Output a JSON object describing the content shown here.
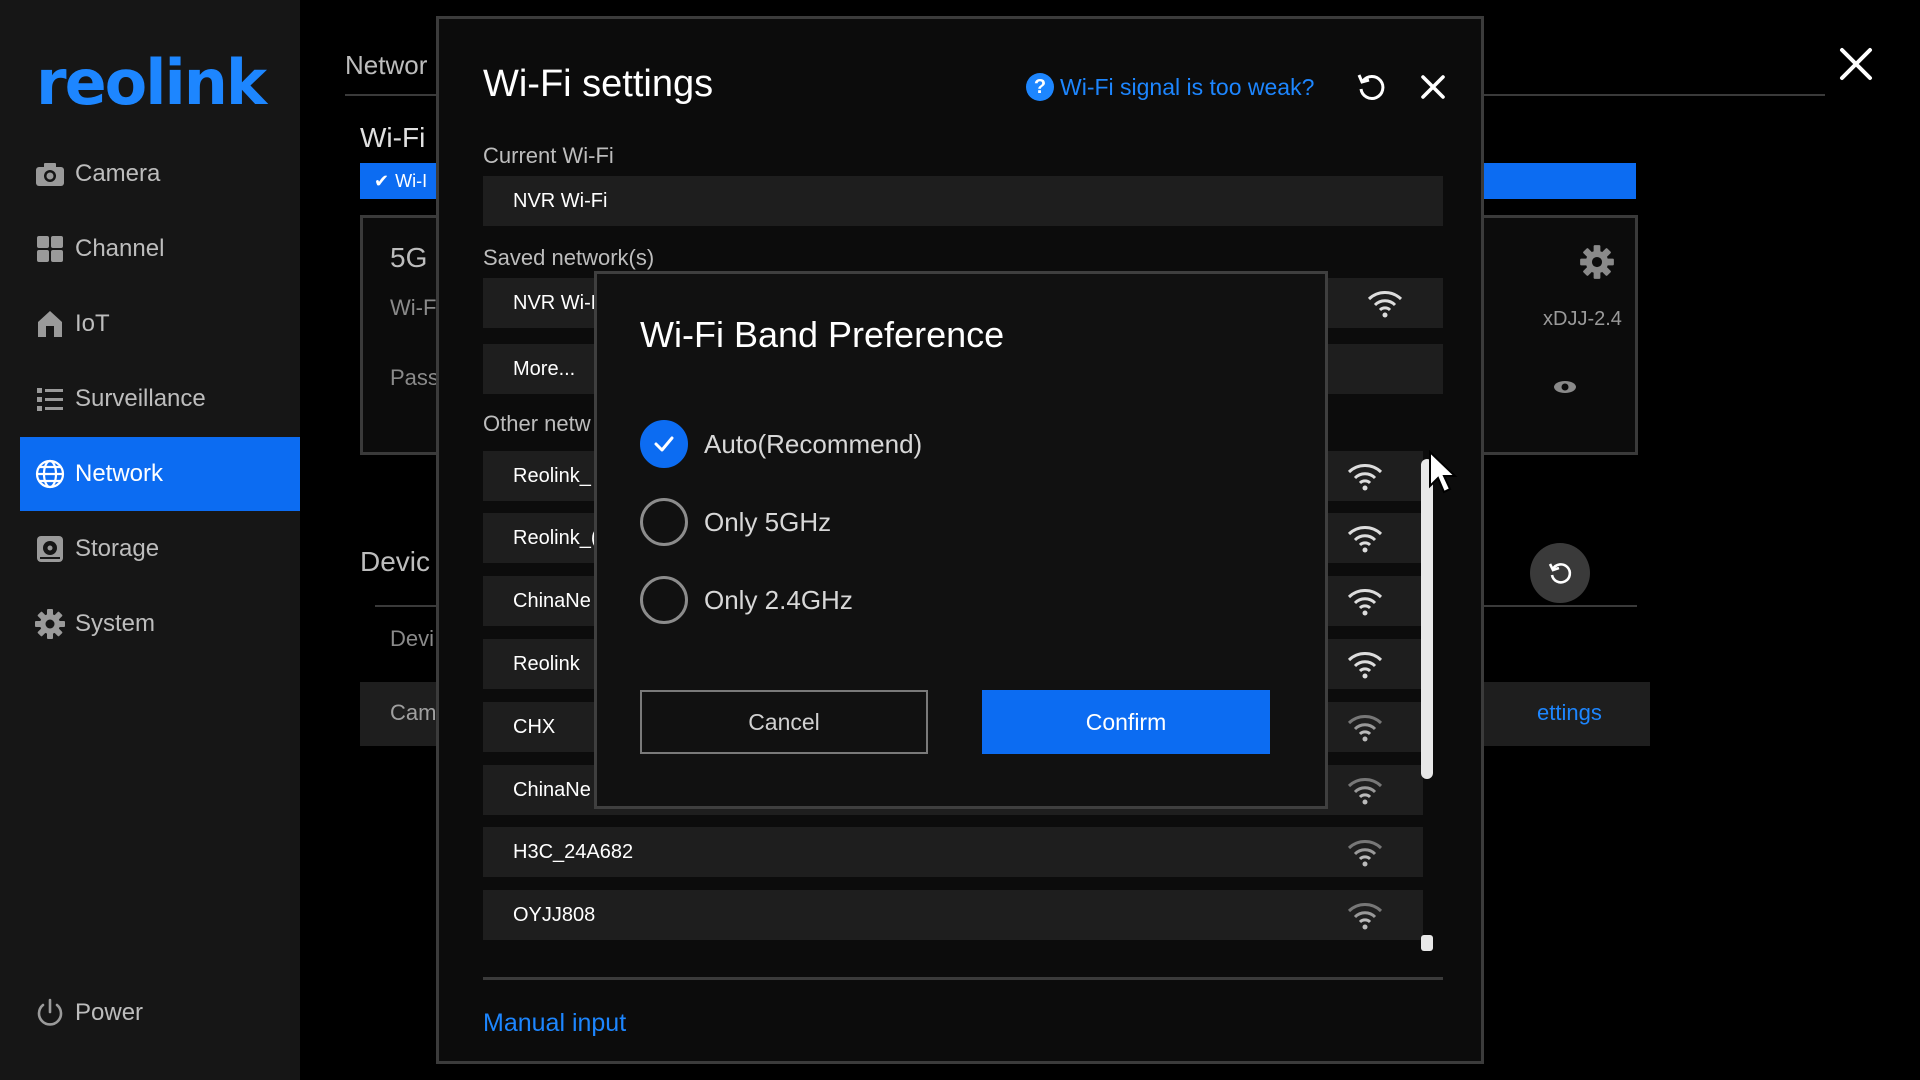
{
  "brand": {
    "logo_text": "reolink",
    "accent": "#0c6cf2",
    "link": "#1d86ff"
  },
  "sidebar": {
    "items": [
      {
        "label": "Camera",
        "icon": "camera-icon"
      },
      {
        "label": "Channel",
        "icon": "grid-icon"
      },
      {
        "label": "IoT",
        "icon": "home-icon"
      },
      {
        "label": "Surveillance",
        "icon": "list-icon"
      },
      {
        "label": "Network",
        "icon": "globe-icon",
        "active": true
      },
      {
        "label": "Storage",
        "icon": "storage-icon"
      },
      {
        "label": "System",
        "icon": "gear-icon"
      }
    ],
    "power_label": "Power"
  },
  "background": {
    "header": "Networ",
    "wifi_heading": "Wi-Fi",
    "wifi_chip": "Wi-I",
    "band_label": "5G",
    "wifi_field": "Wi-F",
    "password_field": "Pass",
    "ssid_fragment": "xDJJ-2.4",
    "device_heading": "Devic",
    "device_row": "Devi",
    "camera_row": "Cam",
    "settings_link": "ettings"
  },
  "wifi_modal": {
    "title": "Wi-Fi settings",
    "weak_signal_link": "Wi-Fi signal is too weak?",
    "current_label": "Current Wi-Fi",
    "current_value": "NVR Wi-Fi",
    "saved_label": "Saved network(s)",
    "saved_items": [
      "NVR Wi-F"
    ],
    "more_label": "More...",
    "other_label": "Other netw",
    "other_items": [
      "Reolink_",
      "Reolink_(",
      "ChinaNe",
      "Reolink",
      "CHX",
      "ChinaNe",
      "H3C_24A682",
      "OYJJ808"
    ],
    "manual_input": "Manual input"
  },
  "band_dialog": {
    "title": "Wi-Fi Band Preference",
    "options": [
      {
        "label": "Auto(Recommend)",
        "selected": true
      },
      {
        "label": "Only 5GHz",
        "selected": false
      },
      {
        "label": "Only 2.4GHz",
        "selected": false
      }
    ],
    "cancel_label": "Cancel",
    "confirm_label": "Confirm"
  }
}
